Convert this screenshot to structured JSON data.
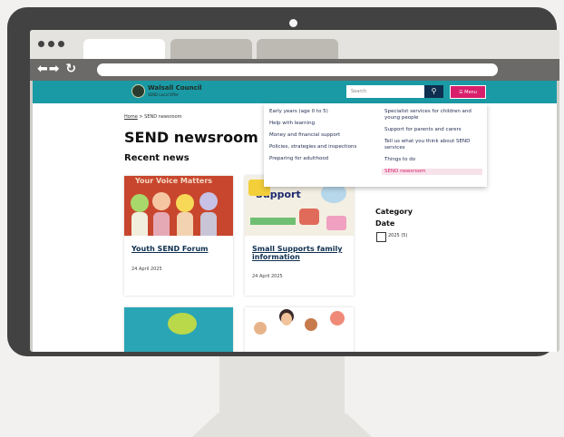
{
  "site": {
    "logo_line1": "Walsall Council",
    "logo_line2": "SEND Local Offer",
    "search_placeholder": "Search",
    "search_icon": "search-icon",
    "menu_label": "Menu",
    "menu_icon": "hamburger-icon"
  },
  "breadcrumb": {
    "home": "Home",
    "separator": ">",
    "current": "SEND newsroom"
  },
  "page_title": "SEND newsroom",
  "recent_news_heading": "Recent news",
  "cards": [
    {
      "title": "Youth SEND Forum",
      "date": "24 April 2025",
      "image_caption": "Your Voice Matters"
    },
    {
      "title": "Small Supports family information",
      "date": "24 April 2025",
      "image_caption": "Support"
    }
  ],
  "filters": {
    "category": "Category",
    "date": "Date",
    "year_option": "2025 (5)"
  },
  "menu": {
    "left": [
      "Early years (age 0 to 5)",
      "Help with learning",
      "Money and financial support",
      "Policies, strategies and inspections",
      "Preparing for adulthood"
    ],
    "right": [
      "Specialist services for children and young people",
      "Support for parents and carers",
      "Tell us what you think about SEND services",
      "Things to do",
      "SEND newsroom"
    ]
  },
  "colors": {
    "header_teal": "#1a9aa5",
    "menu_pink": "#d81f6c",
    "navy": "#0e2f4f"
  }
}
